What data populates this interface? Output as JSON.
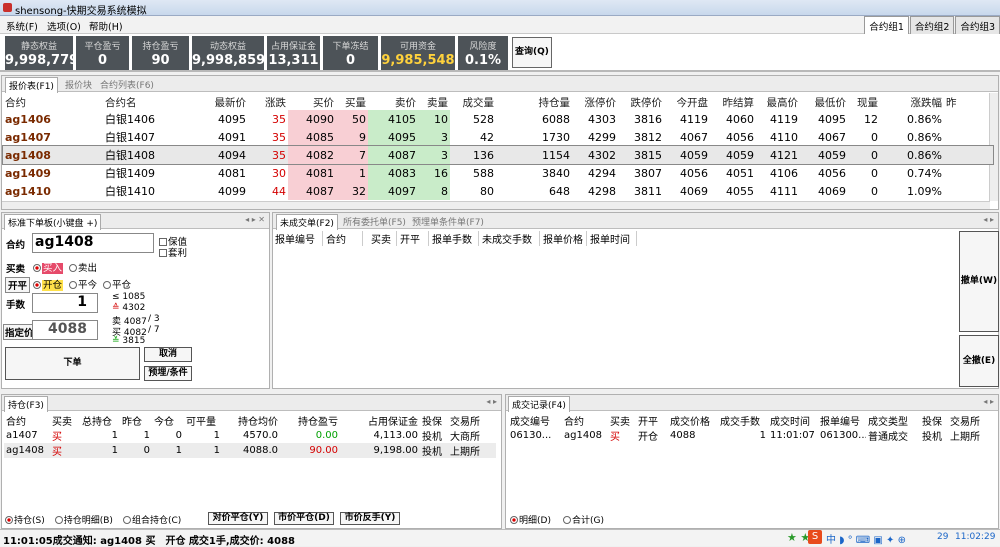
{
  "app": {
    "title": "shensong-快期交易系统模拟"
  },
  "menu": [
    "系统(F)",
    "选项(O)",
    "帮助(H)"
  ],
  "combo_tabs": [
    "合约组1",
    "合约组2",
    "合约组3"
  ],
  "stats": [
    {
      "label": "静态权益",
      "value": "9,998,779"
    },
    {
      "label": "平仓盈亏",
      "value": "0"
    },
    {
      "label": "持仓盈亏",
      "value": "90"
    },
    {
      "label": "动态权益",
      "value": "9,998,859"
    },
    {
      "label": "占用保证金",
      "value": "13,311"
    },
    {
      "label": "下单冻结",
      "value": "0"
    },
    {
      "label": "可用资金",
      "value": "9,985,548"
    },
    {
      "label": "风险度",
      "value": "0.1%"
    }
  ],
  "query_btn": "查询(Q)",
  "quote_tabs": [
    "报价表(F1)",
    "报价块",
    "合约列表(F6)"
  ],
  "quote_headers": [
    "合约",
    "合约名",
    "最新价",
    "涨跌",
    "买价",
    "买量",
    "卖价",
    "卖量",
    "成交量",
    "持仓量",
    "涨停价",
    "跌停价",
    "今开盘",
    "昨结算",
    "最高价",
    "最低价",
    "现量",
    "涨跌幅",
    "昨"
  ],
  "quotes": [
    [
      "ag1406",
      "白银1406",
      "4095",
      "35",
      "4090",
      "50",
      "4105",
      "10",
      "528",
      "6088",
      "4303",
      "3816",
      "4119",
      "4060",
      "4119",
      "4095",
      "12",
      "0.86%"
    ],
    [
      "ag1407",
      "白银1407",
      "4091",
      "35",
      "4085",
      "9",
      "4095",
      "3",
      "42",
      "1730",
      "4299",
      "3812",
      "4067",
      "4056",
      "4110",
      "4067",
      "0",
      "0.86%"
    ],
    [
      "ag1408",
      "白银1408",
      "4094",
      "35",
      "4082",
      "7",
      "4087",
      "3",
      "136",
      "1154",
      "4302",
      "3815",
      "4059",
      "4059",
      "4121",
      "4059",
      "0",
      "0.86%"
    ],
    [
      "ag1409",
      "白银1409",
      "4081",
      "30",
      "4081",
      "1",
      "4083",
      "16",
      "588",
      "3840",
      "4294",
      "3807",
      "4056",
      "4051",
      "4106",
      "4056",
      "0",
      "0.74%"
    ],
    [
      "ag1410",
      "白银1410",
      "4099",
      "44",
      "4087",
      "32",
      "4097",
      "8",
      "80",
      "648",
      "4298",
      "3811",
      "4069",
      "4055",
      "4111",
      "4069",
      "0",
      "1.09%"
    ]
  ],
  "order": {
    "panel_title": "标准下单板(小键盘 +)",
    "contract_label": "合约",
    "contract": "ag1408",
    "hedge": "保值",
    "arbitrage": "套利",
    "dir_label": "买卖",
    "buy": "买入",
    "sell": "卖出",
    "offset_label": "开平",
    "open": "开仓",
    "close_today": "平今",
    "close": "平仓",
    "qty_label": "手数",
    "qty": "1",
    "price_label": "指定价",
    "price": "4088",
    "limit_up": "1085",
    "limit_up2": "4302",
    "ask": "4087",
    "ask_sym": "卖",
    "ask_qty": "3",
    "bid": "4082",
    "bid_sym": "买",
    "bid_qty": "7",
    "limit_down": "3815",
    "submit": "下单",
    "cancel": "取消",
    "preset": "预埋/条件"
  },
  "pending": {
    "tabs": [
      "未成交单(F2)",
      "所有委托单(F5)",
      "预埋单条件单(F7)"
    ],
    "headers": [
      "报单编号",
      "合约",
      "买卖",
      "开平",
      "报单手数",
      "未成交手数",
      "报单价格",
      "报单时间"
    ],
    "cancel_btn": "撤单(W)",
    "cancel_all_btn": "全撤(E)"
  },
  "positions": {
    "tab": "持仓(F3)",
    "headers": [
      "合约",
      "买卖",
      "总持仓",
      "昨仓",
      "今仓",
      "可平量",
      "持仓均价",
      "持仓盈亏",
      "占用保证金",
      "投保",
      "交易所"
    ],
    "rows": [
      [
        "a1407",
        "买",
        "1",
        "1",
        "0",
        "1",
        "4570.0",
        "0.00",
        "4,113.00",
        "投机",
        "大商所"
      ],
      [
        "ag1408",
        "买",
        "1",
        "0",
        "1",
        "1",
        "4088.0",
        "90.00",
        "9,198.00",
        "投机",
        "上期所"
      ]
    ],
    "radios": [
      "持仓(S)",
      "持仓明细(B)",
      "组合持仓(C)"
    ],
    "buttons": [
      "对价平仓(Y)",
      "市价平仓(D)",
      "市价反手(Y)"
    ]
  },
  "trades": {
    "tab": "成交记录(F4)",
    "headers": [
      "成交编号",
      "合约",
      "买卖",
      "开平",
      "成交价格",
      "成交手数",
      "成交时间",
      "报单编号",
      "成交类型",
      "投保",
      "交易所"
    ],
    "rows": [
      [
        "06130...",
        "ag1408",
        "买",
        "开仓",
        "4088",
        "1",
        "11:01:07",
        "061300...",
        "普通成交",
        "投机",
        "上期所"
      ]
    ],
    "radios": [
      "明细(D)",
      "合计(G)"
    ]
  },
  "status": {
    "message": "11:01:05成交通知: ag1408 买　开仓 成交1手,成交价: 4088",
    "time1": "29",
    "time2": "11:02:29"
  },
  "colors": {
    "gold": "#ffd23c",
    "red": "#d40000",
    "green": "#00a000",
    "stat_bg": "#4d5358"
  }
}
